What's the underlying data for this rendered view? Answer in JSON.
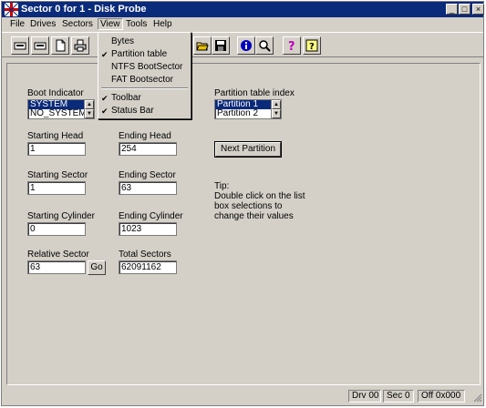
{
  "window": {
    "title": "Sector 0 for 1 - Disk Probe",
    "minimize_glyph": "_",
    "maximize_glyph": "□",
    "close_glyph": "×"
  },
  "menubar": {
    "items": [
      {
        "label": "File"
      },
      {
        "label": "Drives"
      },
      {
        "label": "Sectors"
      },
      {
        "label": "View"
      },
      {
        "label": "Tools"
      },
      {
        "label": "Help"
      }
    ]
  },
  "view_menu": {
    "items": [
      {
        "label": "Bytes",
        "checked": false
      },
      {
        "label": "Partition table",
        "checked": true
      },
      {
        "label": "NTFS BootSector",
        "checked": false
      },
      {
        "label": "FAT Bootsector",
        "checked": false
      },
      {
        "label": "Toolbar",
        "checked": true
      },
      {
        "label": "Status Bar",
        "checked": true
      }
    ],
    "check_glyph": "✔"
  },
  "form": {
    "boot_indicator": {
      "label": "Boot Indicator",
      "options": [
        "SYSTEM",
        "NO_SYSTEM"
      ],
      "selected": "SYSTEM"
    },
    "partition_table_index": {
      "label": "Partition table index",
      "options": [
        "Partition 1",
        "Partition 2"
      ],
      "selected": "Partition 1"
    },
    "starting_head": {
      "label": "Starting Head",
      "value": "1"
    },
    "ending_head": {
      "label": "Ending Head",
      "value": "254"
    },
    "starting_sector": {
      "label": "Starting Sector",
      "value": "1"
    },
    "ending_sector": {
      "label": "Ending Sector",
      "value": "63"
    },
    "starting_cylinder": {
      "label": "Starting Cylinder",
      "value": "0"
    },
    "ending_cylinder": {
      "label": "Ending Cylinder",
      "value": "1023"
    },
    "relative_sector": {
      "label": "Relative Sector",
      "value": "63"
    },
    "total_sectors": {
      "label": "Total Sectors",
      "value": "62091162"
    },
    "go_button": "Go",
    "next_partition_button": "Next Partition",
    "tip": {
      "title": "Tip:",
      "lines": [
        "Double click on the list",
        "box selections to",
        "change their values"
      ]
    }
  },
  "statusbar": {
    "drive": "Drv 00",
    "sector": "Sec 0",
    "offset": "Off 0x000"
  },
  "spinner_glyphs": {
    "up": "▲",
    "down": "▼"
  },
  "colors": {
    "titlebar": "#0a2a7a",
    "face": "#d4d0c8",
    "selection": "#0a2a7a"
  },
  "toolbar_icons": [
    "read-sector-icon",
    "write-sector-icon",
    "new-document-icon",
    "print-icon",
    "open-folder-icon",
    "save-icon",
    "info-icon",
    "find-icon",
    "help-icon",
    "context-help-icon"
  ]
}
